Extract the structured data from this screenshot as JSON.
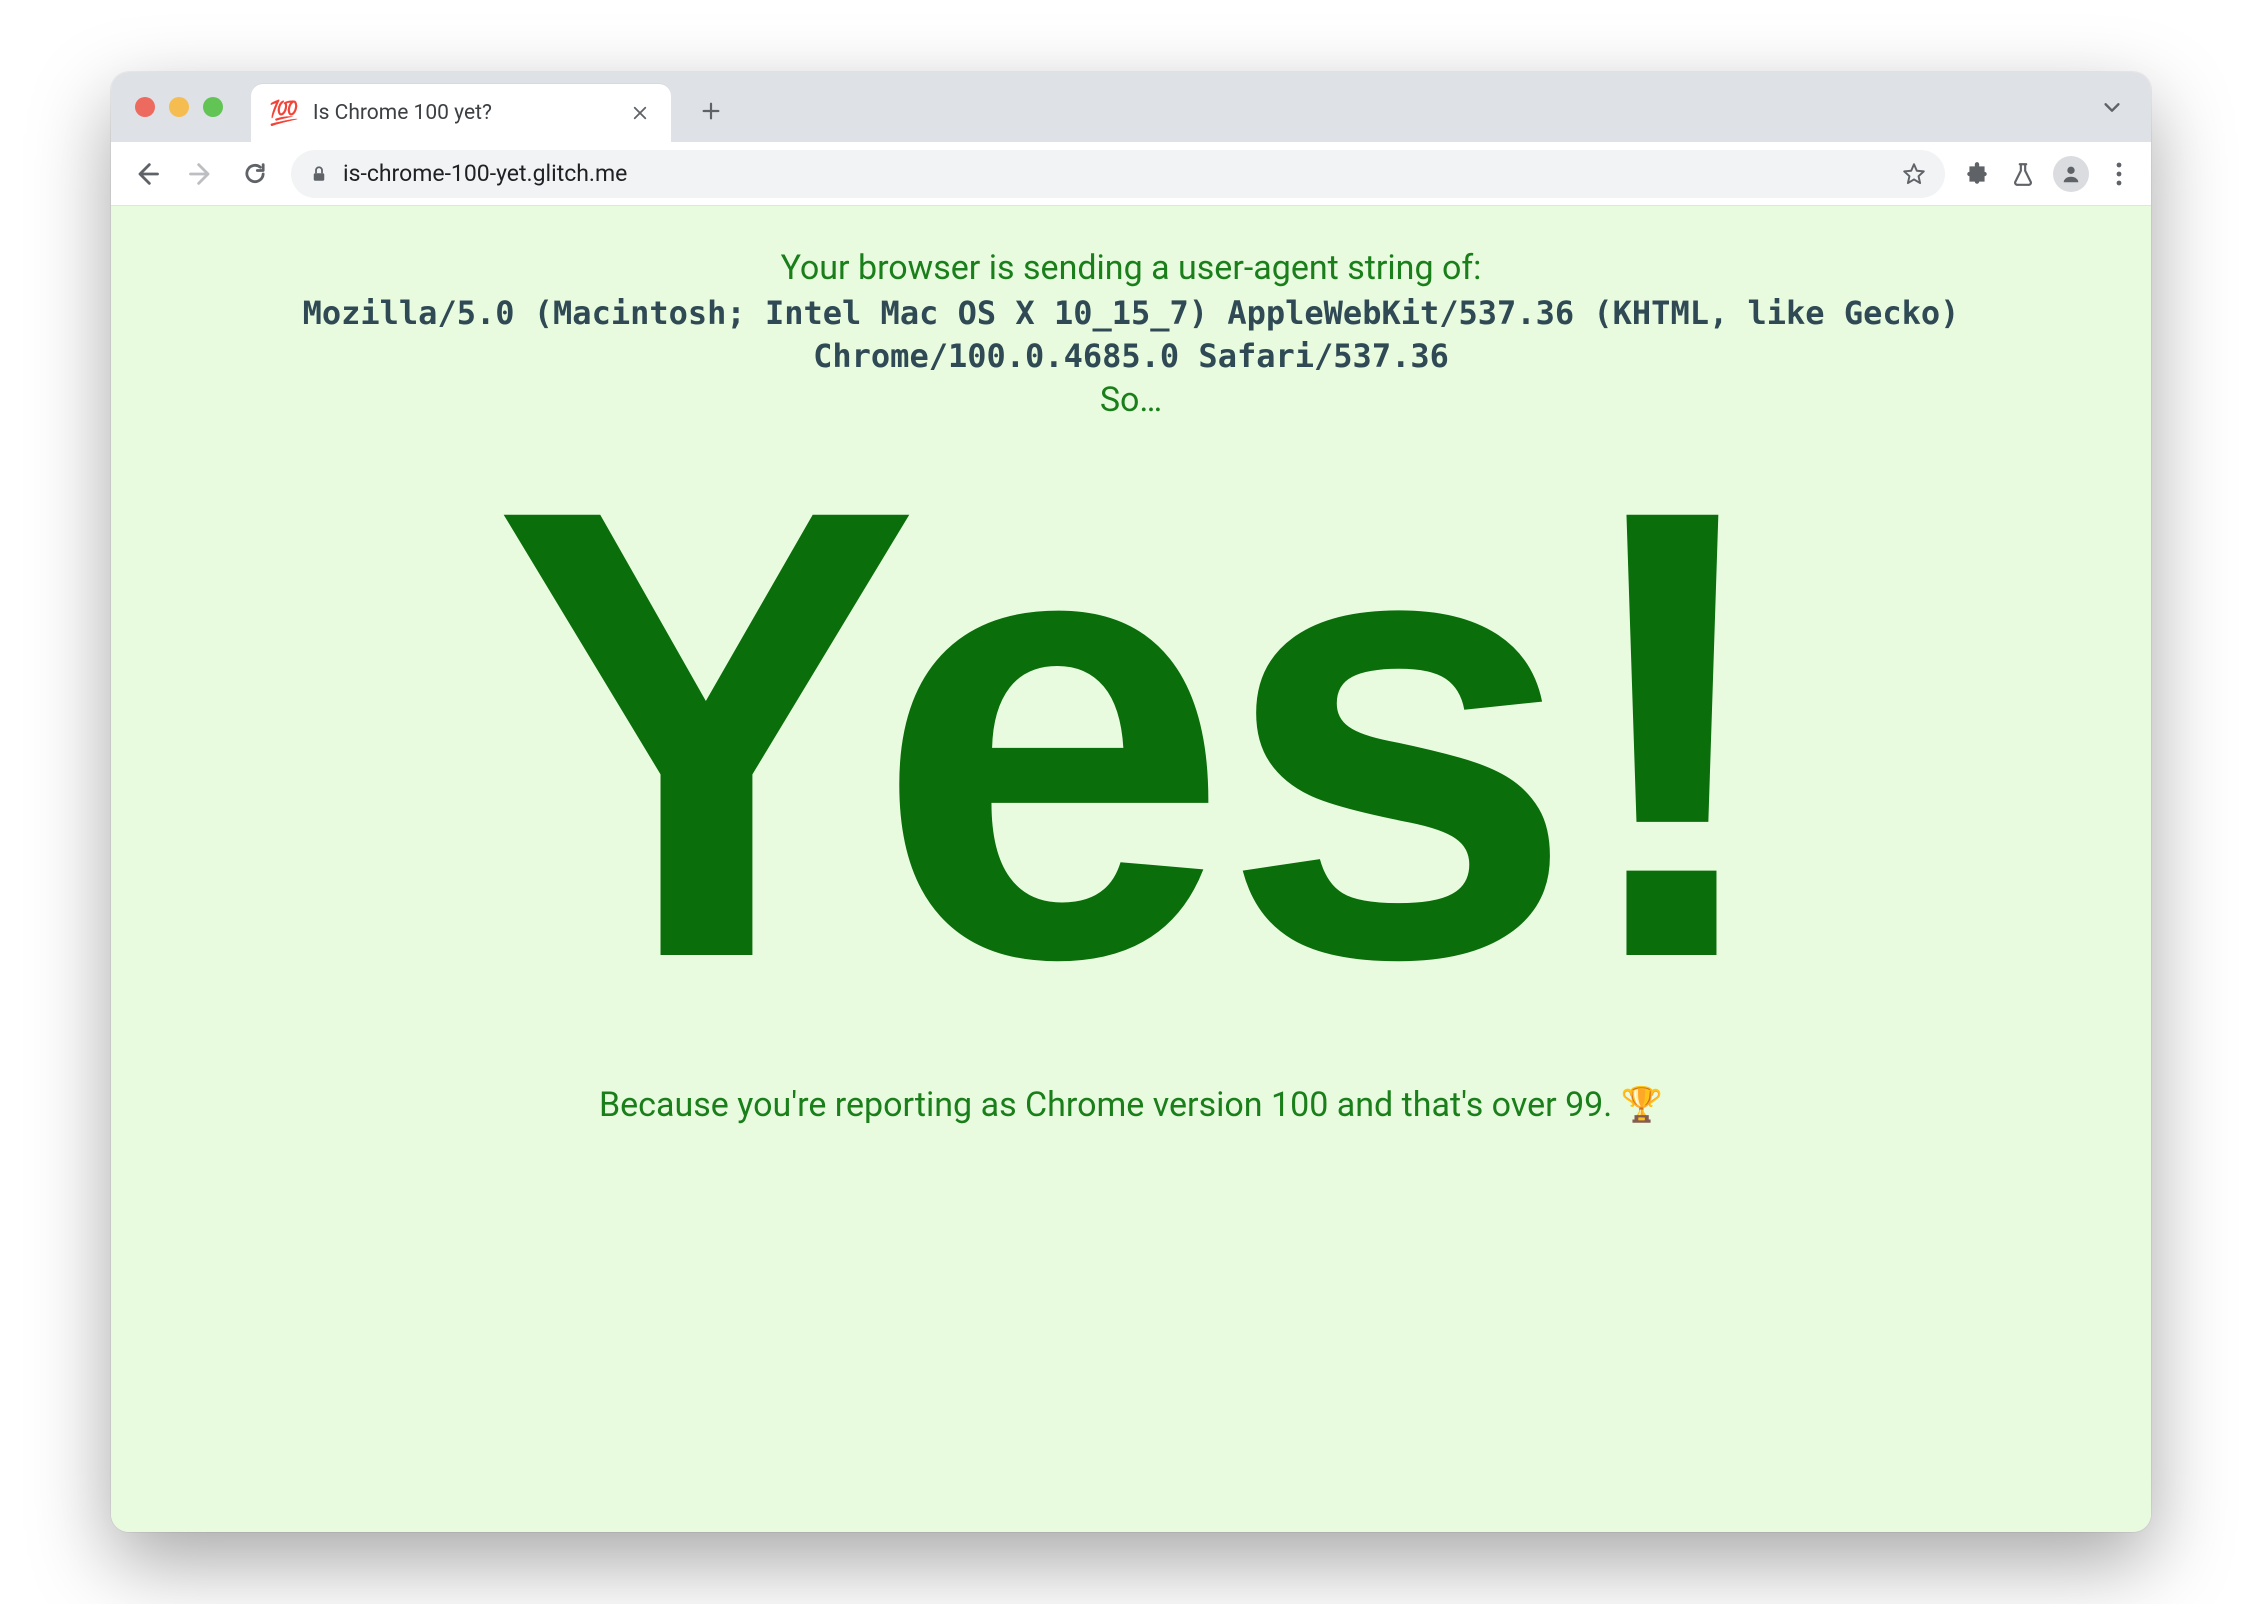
{
  "chrome": {
    "tab": {
      "favicon": "💯",
      "title": "Is Chrome 100 yet?"
    },
    "url": "is-chrome-100-yet.glitch.me"
  },
  "page": {
    "intro": "Your browser is sending a user-agent string of:",
    "ua": "Mozilla/5.0 (Macintosh; Intel Mac OS X 10_15_7) AppleWebKit/537.36 (KHTML, like Gecko) Chrome/100.0.4685.0 Safari/537.36",
    "so": "So…",
    "answer": "Yes!",
    "because": "Because you're reporting as Chrome version 100 and that's over 99. 🏆"
  }
}
